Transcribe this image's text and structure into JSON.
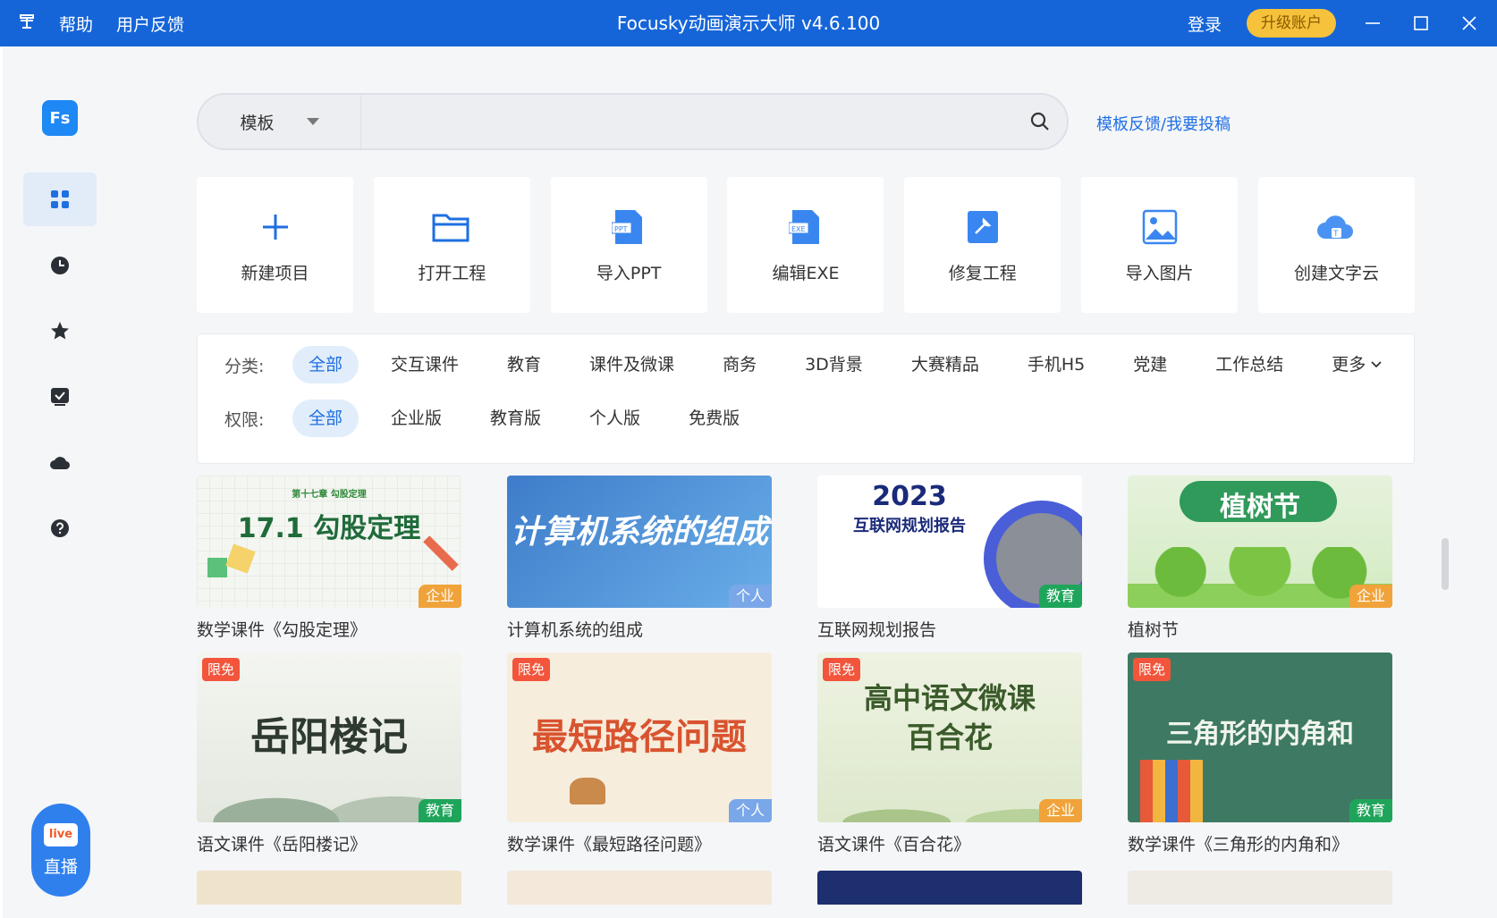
{
  "titlebar": {
    "menu_help": "帮助",
    "menu_feedback": "用户反馈",
    "title": "Focusky动画演示大师 v4.6.100",
    "login": "登录",
    "upgrade": "升级账户"
  },
  "sidebar": {
    "logo": "Fs",
    "live_icon_text": "live",
    "live_label": "直播"
  },
  "search": {
    "category": "模板",
    "placeholder": "",
    "feedback_link": "模板反馈/我要投稿"
  },
  "tiles": [
    {
      "label": "新建项目",
      "icon": "plus-icon"
    },
    {
      "label": "打开工程",
      "icon": "folder-icon"
    },
    {
      "label": "导入PPT",
      "icon": "ppt-file-icon"
    },
    {
      "label": "编辑EXE",
      "icon": "exe-file-icon"
    },
    {
      "label": "修复工程",
      "icon": "repair-icon"
    },
    {
      "label": "导入图片",
      "icon": "image-icon"
    },
    {
      "label": "创建文字云",
      "icon": "cloud-text-icon"
    }
  ],
  "filters": {
    "category_label": "分类:",
    "categories": [
      "全部",
      "交互课件",
      "教育",
      "课件及微课",
      "商务",
      "3D背景",
      "大赛精品",
      "手机H5",
      "党建",
      "工作总结",
      "更多"
    ],
    "permission_label": "权限:",
    "permissions": [
      "全部",
      "企业版",
      "教育版",
      "个人版",
      "免费版"
    ]
  },
  "cards": [
    {
      "caption": "数学课件《勾股定理》",
      "thumb_title": "17.1 勾股定理",
      "thumb_sub": "第十七章 勾股定理",
      "tag": "企业"
    },
    {
      "caption": "计算机系统的组成",
      "thumb_title": "计算机系统的组成",
      "tag": "个人"
    },
    {
      "caption": "互联网规划报告",
      "thumb_title": "2023",
      "thumb_sub": "互联网规划报告",
      "tag": "教育"
    },
    {
      "caption": "植树节",
      "thumb_title": "植树节",
      "tag": "企业"
    },
    {
      "caption": "语文课件《岳阳楼记》",
      "thumb_title": "岳阳楼记",
      "tag": "教育",
      "limited": "限免"
    },
    {
      "caption": "数学课件《最短路径问题》",
      "thumb_title": "最短路径问题",
      "tag": "个人",
      "limited": "限免"
    },
    {
      "caption": "语文课件《百合花》",
      "thumb_title": "高中语文微课",
      "thumb_sub": "百合花",
      "tag": "企业",
      "limited": "限免"
    },
    {
      "caption": "数学课件《三角形的内角和》",
      "thumb_title": "三角形的内角和",
      "tag": "教育",
      "limited": "限免"
    }
  ]
}
